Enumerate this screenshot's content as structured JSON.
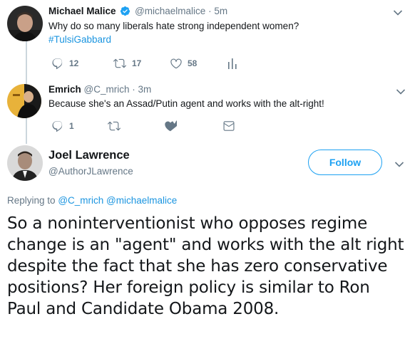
{
  "tweet1": {
    "name": "Michael Malice",
    "handle": "@michaelmalice",
    "sep": "·",
    "time": "5m",
    "text": "Why do so many liberals hate strong independent women?",
    "hashtag": "#TulsiGabbard",
    "reply_count": "12",
    "retweet_count": "17",
    "like_count": "58"
  },
  "tweet2": {
    "name": "Emrich",
    "handle": "@C_mrich",
    "sep": "·",
    "time": "3m",
    "text": "Because she's an Assad/Putin agent and works with the alt-right!",
    "reply_count": "1"
  },
  "main_tweet": {
    "name": "Joel Lawrence",
    "handle": "@AuthorJLawrence",
    "follow_label": "Follow",
    "replying_prefix": "Replying to",
    "replying_to_1": "@C_mrich",
    "replying_to_2": "@michaelmalice",
    "text": "So a noninterventionist who opposes regime change is an \"agent\" and works with the alt right despite the fact that she has zero conservative positions? Her foreign policy is similar to Ron Paul and Candidate Obama 2008."
  },
  "colors": {
    "accent": "#1da1f2",
    "link": "#1b95e0",
    "muted": "#657786",
    "text": "#14171a",
    "thread_line": "#ccd6dd"
  },
  "icons": [
    "reply-icon",
    "retweet-icon",
    "like-icon",
    "analytics-icon",
    "dm-icon",
    "verified-badge-icon",
    "chevron-down-icon"
  ]
}
